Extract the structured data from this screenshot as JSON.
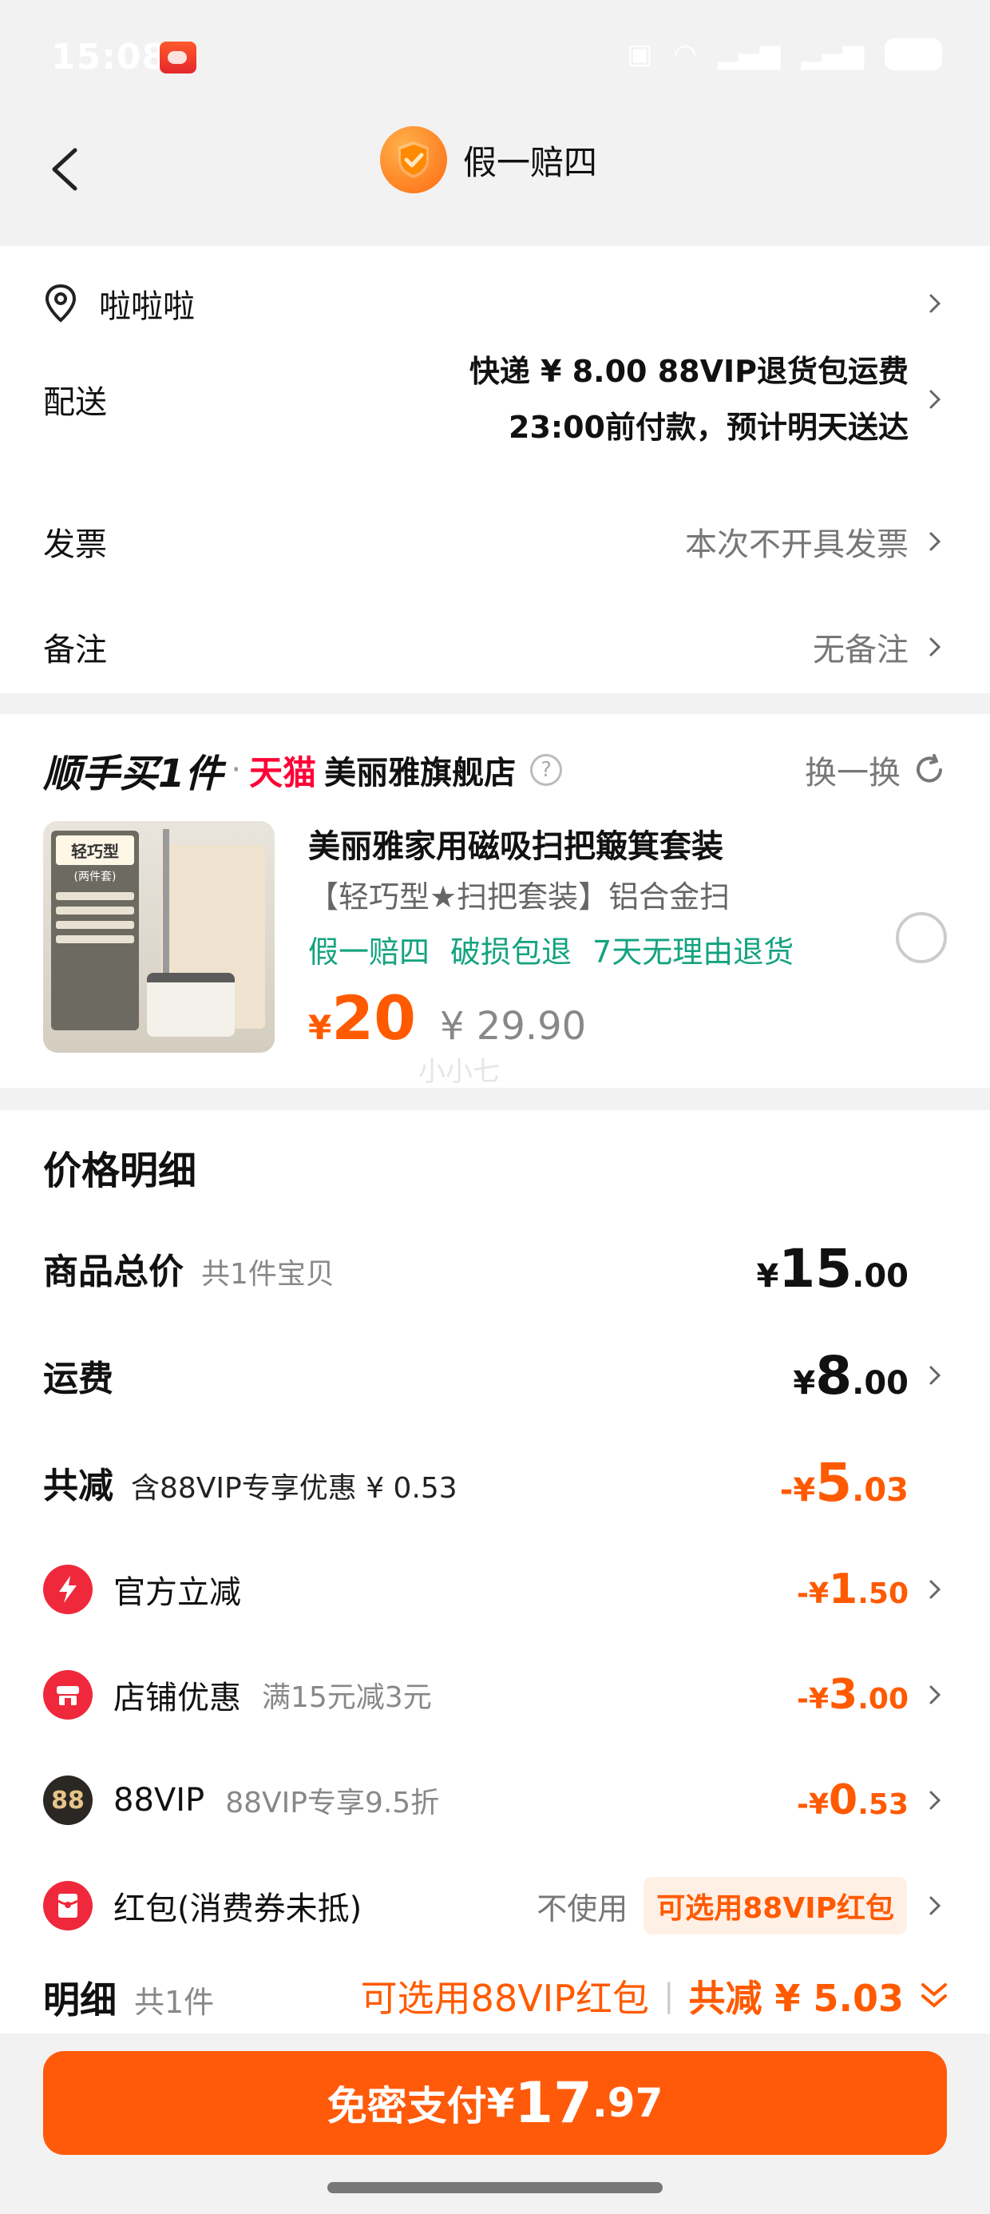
{
  "status": {
    "time": "15:08"
  },
  "nav": {
    "title": "假一赔四"
  },
  "address": {
    "text": "啦啦啦"
  },
  "shipping": {
    "label": "配送",
    "line1": "快递 ¥ 8.00 88VIP退货包运费",
    "line2": "23:00前付款，预计明天送达"
  },
  "invoice": {
    "label": "发票",
    "value": "本次不开具发票"
  },
  "remark": {
    "label": "备注",
    "value": "无备注"
  },
  "addon": {
    "title": "顺手买1件",
    "dot": "·",
    "tmall": "天猫",
    "store": "美丽雅旗舰店",
    "help": "?",
    "swap": "换一换",
    "thumb_badge": "轻巧型",
    "thumb_sub": "(两件套)",
    "product": {
      "name": "美丽雅家用磁吸扫把簸箕套装",
      "sku": "【轻巧型★扫把套装】铝合金扫",
      "tags": [
        "假一赔四",
        "破损包退",
        "7天无理由退货"
      ],
      "price_symbol": "¥",
      "price": "20",
      "original_price": "¥ 29.90",
      "watermark": "小小七"
    }
  },
  "price_detail": {
    "title": "价格明细",
    "subtotal": {
      "label": "商品总价",
      "sub": "共1件宝贝",
      "symbol": "¥",
      "int": "15",
      "dec": ".00"
    },
    "freight": {
      "label": "运费",
      "symbol": "¥",
      "int": "8",
      "dec": ".00"
    },
    "total_discount": {
      "label": "共减",
      "sub": "含88VIP专享优惠 ¥ 0.53",
      "sign": "-¥",
      "int": "5",
      "dec": ".03"
    },
    "items": [
      {
        "label": "官方立减",
        "sub": "",
        "sign": "-¥",
        "int": "1",
        "dec": ".50"
      },
      {
        "label": "店铺优惠",
        "sub": "满15元减3元",
        "sign": "-¥",
        "int": "3",
        "dec": ".00"
      },
      {
        "label": "88VIP",
        "sub": "88VIP专享9.5折",
        "sign": "-¥",
        "int": "0",
        "dec": ".53"
      }
    ],
    "redpacket": {
      "label": "红包(消费券未抵)",
      "unused": "不使用",
      "tag": "可选用88VIP红包"
    }
  },
  "summary": {
    "label": "明细",
    "count": "共1件",
    "hint": "可选用88VIP红包",
    "divider": "|",
    "saved": "共减 ¥ 5.03"
  },
  "pay": {
    "label": "免密支付",
    "symbol": "¥",
    "int": "17",
    "dec": ".97"
  },
  "colors": {
    "accent": "#ff5a0a",
    "green": "#13a37f",
    "tmall_red": "#ff0036"
  }
}
